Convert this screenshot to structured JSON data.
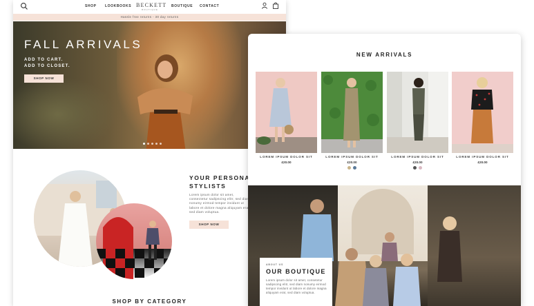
{
  "left_page": {
    "nav": {
      "items": [
        "SHOP",
        "LOOKBOOKS",
        "BOUTIQUE",
        "CONTACT"
      ],
      "logo": "BECKETT",
      "logo_sub": "BOUTIQUE",
      "icons": [
        "search-icon",
        "user-icon",
        "bag-icon"
      ]
    },
    "promo": "Hassle free returns  -  30 day returns",
    "hero": {
      "title": "FALL ARRIVALS",
      "tagline_1": "ADD TO CART.",
      "tagline_2": "ADD TO CLOSET.",
      "button": "SHOP NOW",
      "slides": 5
    },
    "stylists": {
      "title_1": "YOUR PERSONAL",
      "title_2": "STYLISTS",
      "body": "Lorem ipsum dolor sit amet, consectetur sadipscing elitr, sed diam nonumy eirmod tempor invidunt ut labore et dolore magna aliquyam erat, sed diam voluptua.",
      "button": "SHOP NOW"
    },
    "category_title": "SHOP BY CATEGORY"
  },
  "right_page": {
    "new_arrivals_title": "NEW ARRIVALS",
    "products": [
      {
        "name": "LOREM IPSUM DOLOR SIT",
        "price": "£20.00",
        "swatches": []
      },
      {
        "name": "LOREM IPSUM DOLOR SIT",
        "price": "£20.00",
        "swatches": [
          "#c9b48a",
          "#5b7a99"
        ]
      },
      {
        "name": "LOREM IPSUM DOLOR SIT",
        "price": "£20.00",
        "swatches": [
          "#555555",
          "#d9b9c2"
        ]
      },
      {
        "name": "LOREM IPSUM DOLOR SIT",
        "price": "£20.00",
        "swatches": []
      }
    ],
    "about": {
      "kicker": "ABOUT US",
      "title": "OUR BOUTIQUE",
      "body": "Lorem ipsum dolor sit amet, consetetur sadipscing elitr, sed diam nonumy eirmod tempor invidunt ut labore et dolore magna aliquyam erat, sed diam voluptua."
    }
  },
  "colors": {
    "accent_pink": "#f6e2d8",
    "text_dark": "#222222"
  }
}
